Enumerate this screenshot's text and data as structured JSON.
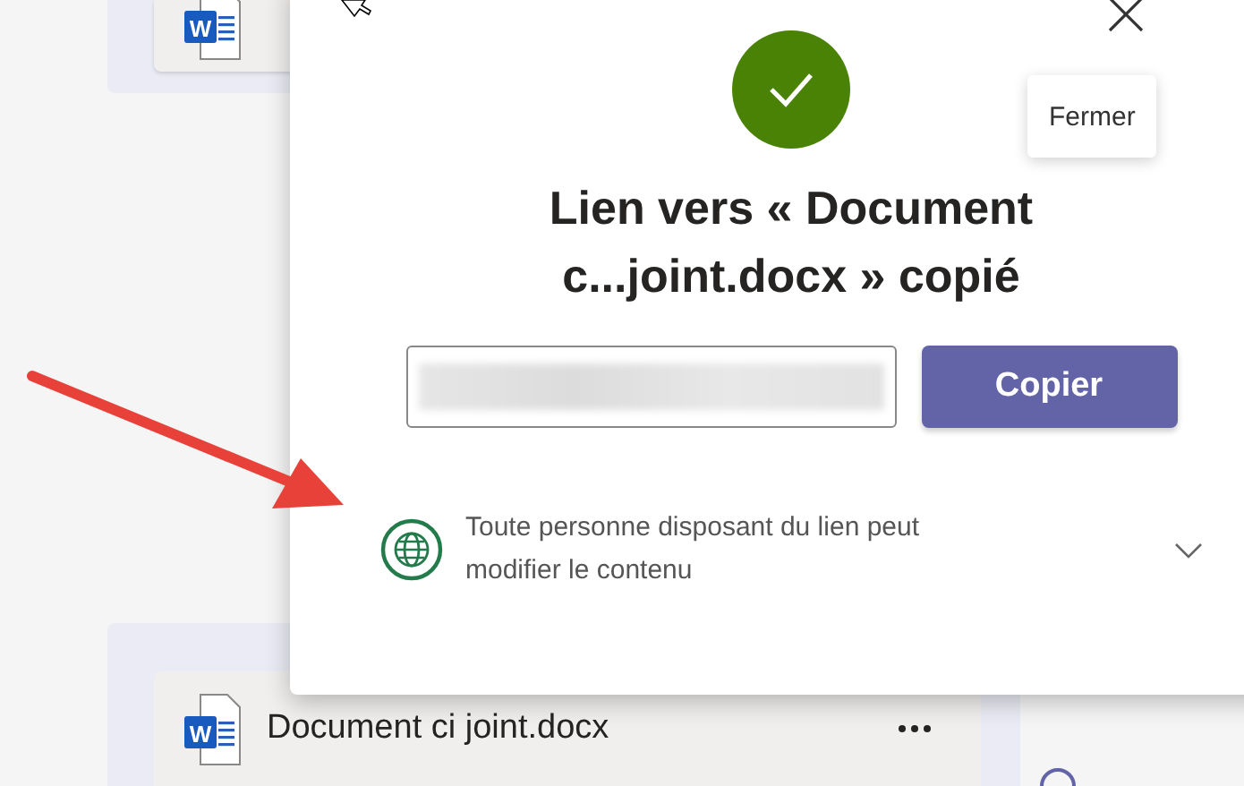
{
  "files": [
    {
      "logo_letter": "W"
    },
    {
      "logo_letter": "W",
      "name": "Document ci joint.docx"
    }
  ],
  "dialog": {
    "success": true,
    "title": "Lien vers « Document c...joint.docx » copié",
    "close_tooltip": "Fermer",
    "link_field": {
      "redacted": true
    },
    "copy_button": "Copier",
    "permission": {
      "text": "Toute personne disposant du lien peut modifier le contenu",
      "expanded": false
    }
  }
}
